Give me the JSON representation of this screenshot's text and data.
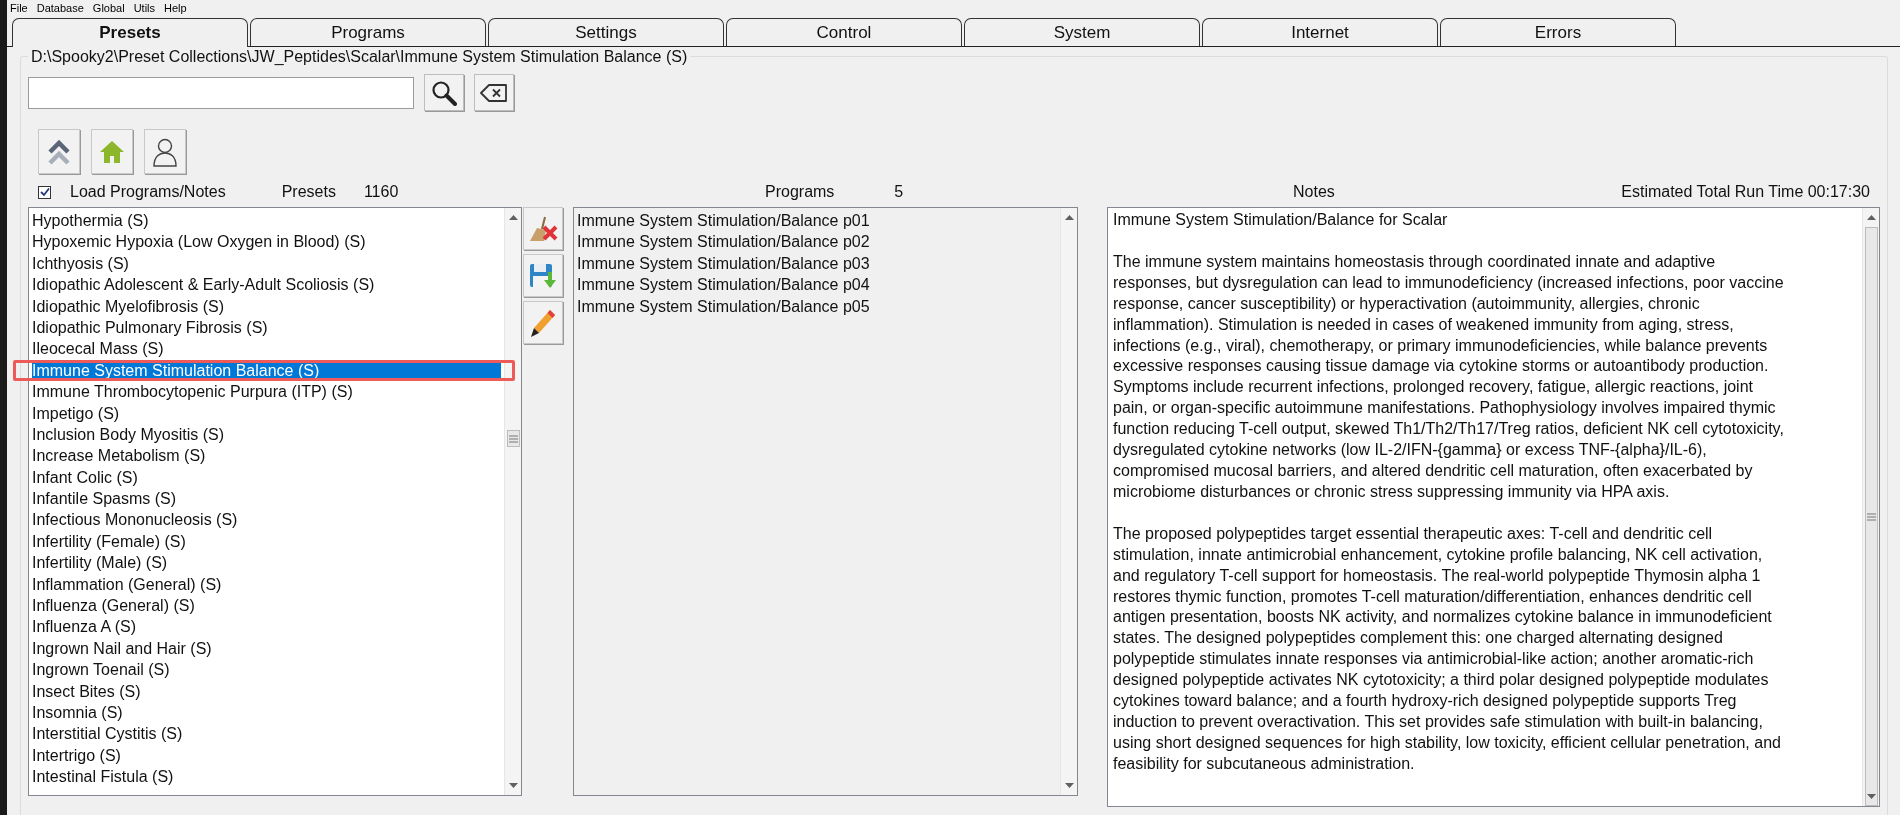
{
  "menu": [
    "File",
    "Database",
    "Global",
    "Utils",
    "Help"
  ],
  "tabs": [
    {
      "label": "Presets",
      "selected": true
    },
    {
      "label": "Programs",
      "selected": false
    },
    {
      "label": "Settings",
      "selected": false
    },
    {
      "label": "Control",
      "selected": false
    },
    {
      "label": "System",
      "selected": false
    },
    {
      "label": "Internet",
      "selected": false
    },
    {
      "label": "Errors",
      "selected": false
    }
  ],
  "path": "D:\\Spooky2\\Preset Collections\\JW_Peptides\\Scalar\\Immune System Stimulation Balance (S)",
  "load_programs_notes": {
    "label": "Load Programs/Notes",
    "checked": true
  },
  "presets_label": "Presets",
  "presets_count": "1160",
  "programs_label": "Programs",
  "programs_count": "5",
  "notes_label": "Notes",
  "run_time": "Estimated Total Run Time 00:17:30",
  "presets": [
    {
      "name": "Hypothermia (S)",
      "selected": false,
      "marked": false
    },
    {
      "name": "Hypoxemic Hypoxia (Low Oxygen in Blood) (S)",
      "selected": false,
      "marked": false
    },
    {
      "name": "Ichthyosis (S)",
      "selected": false,
      "marked": false
    },
    {
      "name": "Idiopathic Adolescent & Early-Adult Scoliosis (S)",
      "selected": false,
      "marked": false
    },
    {
      "name": "Idiopathic Myelofibrosis (S)",
      "selected": false,
      "marked": false
    },
    {
      "name": "Idiopathic Pulmonary Fibrosis (S)",
      "selected": false,
      "marked": false
    },
    {
      "name": "Ileocecal Mass (S)",
      "selected": false,
      "marked": false
    },
    {
      "name": "Immune System Stimulation Balance (S)",
      "selected": true,
      "marked": true
    },
    {
      "name": "Immune Thrombocytopenic Purpura (ITP) (S)",
      "selected": false,
      "marked": false
    },
    {
      "name": "Impetigo (S)",
      "selected": false,
      "marked": false
    },
    {
      "name": "Inclusion Body Myositis (S)",
      "selected": false,
      "marked": false
    },
    {
      "name": "Increase Metabolism (S)",
      "selected": false,
      "marked": false
    },
    {
      "name": "Infant Colic (S)",
      "selected": false,
      "marked": false
    },
    {
      "name": "Infantile Spasms (S)",
      "selected": false,
      "marked": false
    },
    {
      "name": "Infectious Mononucleosis (S)",
      "selected": false,
      "marked": false
    },
    {
      "name": "Infertility (Female) (S)",
      "selected": false,
      "marked": false
    },
    {
      "name": "Infertility (Male) (S)",
      "selected": false,
      "marked": false
    },
    {
      "name": "Inflammation (General) (S)",
      "selected": false,
      "marked": false
    },
    {
      "name": "Influenza (General) (S)",
      "selected": false,
      "marked": false
    },
    {
      "name": "Influenza A (S)",
      "selected": false,
      "marked": false
    },
    {
      "name": "Ingrown Nail and Hair (S)",
      "selected": false,
      "marked": false
    },
    {
      "name": "Ingrown Toenail (S)",
      "selected": false,
      "marked": false
    },
    {
      "name": "Insect Bites (S)",
      "selected": false,
      "marked": false
    },
    {
      "name": "Insomnia (S)",
      "selected": false,
      "marked": false
    },
    {
      "name": "Interstitial Cystitis (S)",
      "selected": false,
      "marked": false
    },
    {
      "name": "Intertrigo (S)",
      "selected": false,
      "marked": false
    },
    {
      "name": "Intestinal Fistula (S)",
      "selected": false,
      "marked": false
    }
  ],
  "programs": [
    "Immune System Stimulation/Balance p01",
    "Immune System Stimulation/Balance p02",
    "Immune System Stimulation/Balance p03",
    "Immune System Stimulation/Balance p04",
    "Immune System Stimulation/Balance p05"
  ],
  "notes": [
    "Immune System Stimulation/Balance for Scalar",
    "The immune system maintains homeostasis through coordinated innate and adaptive responses, but dysregulation can lead to immunodeficiency (increased infections, poor vaccine response, cancer susceptibility) or hyperactivation (autoimmunity, allergies, chronic inflammation). Stimulation is needed in cases of weakened immunity from aging, stress, infections (e.g., viral), chemotherapy, or primary immunodeficiencies, while balance prevents excessive responses causing tissue damage via cytokine storms or autoantibody production. Symptoms include recurrent infections, prolonged recovery, fatigue, allergic reactions, joint pain, or organ-specific autoimmune manifestations. Pathophysiology involves impaired thymic function reducing T-cell output, skewed Th1/Th2/Th17/Treg ratios, deficient NK cell cytotoxicity, dysregulated cytokine networks (low IL-2/IFN-{gamma} or excess TNF-{alpha}/IL-6), compromised mucosal barriers, and altered dendritic cell maturation, often exacerbated by microbiome disturbances or chronic stress suppressing immunity via HPA axis.",
    "The proposed polypeptides target essential therapeutic axes: T-cell and dendritic cell stimulation, innate antimicrobial enhancement, cytokine profile balancing, NK cell activation, and regulatory T-cell support for homeostasis. The real-world polypeptide Thymosin alpha 1 restores thymic function, promotes T-cell maturation/differentiation, enhances dendritic cell antigen presentation, boosts NK activity, and normalizes cytokine balance in immunodeficient states. The designed polypeptides complement this: one charged alternating designed polypeptide stimulates innate responses via antimicrobial-like action; another aromatic-rich designed polypeptide activates NK cytotoxicity; a third polar designed polypeptide modulates cytokines toward balance; and a fourth hydroxy-rich designed polypeptide supports Treg induction to prevent overactivation. This set provides safe stimulation with built-in balancing, using short designed sequences for high stability, low toxicity, efficient cellular penetration, and feasibility for subcutaneous administration."
  ]
}
